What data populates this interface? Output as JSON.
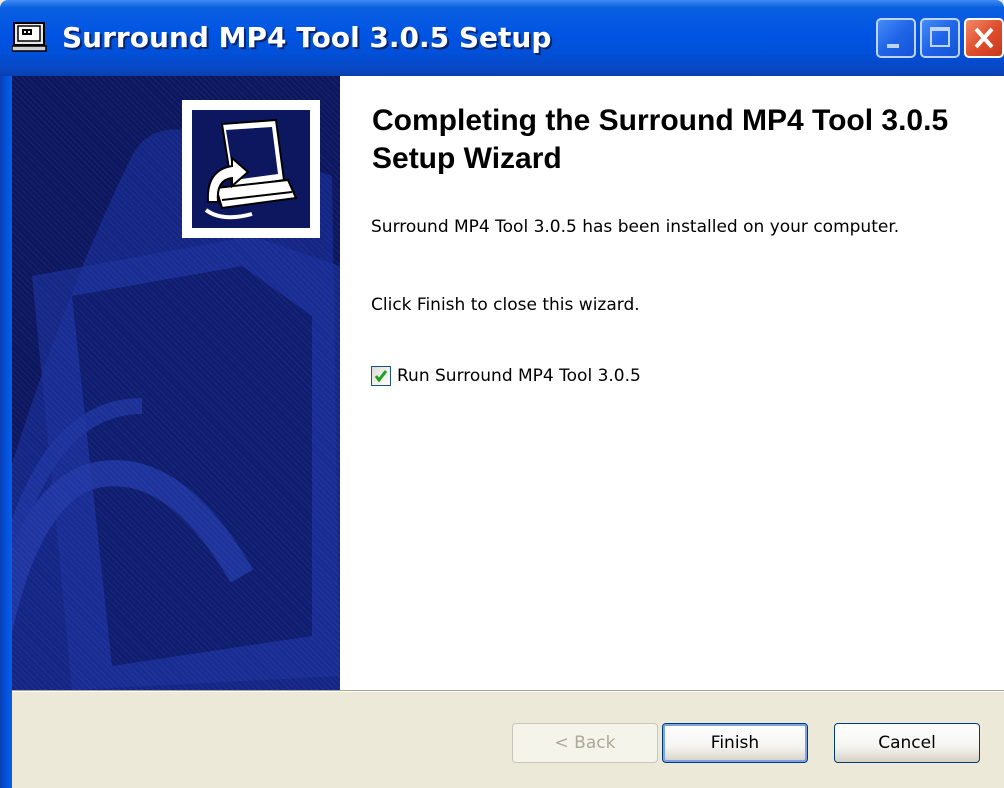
{
  "window": {
    "title": "Surround MP4 Tool 3.0.5 Setup",
    "icons": {
      "app": "installer-app-icon",
      "minimize": "minimize-icon",
      "maximize": "maximize-icon",
      "close": "close-icon"
    },
    "colors": {
      "titlebar": "#0054e3",
      "banner": "#0c1760",
      "close_button": "#e0502e"
    }
  },
  "banner": {
    "logo_icon": "computer-install-icon"
  },
  "content": {
    "heading": "Completing the Surround MP4 Tool 3.0.5 Setup Wizard",
    "paragraph1": "Surround MP4 Tool 3.0.5 has been installed on your computer.",
    "paragraph2": "Click Finish to close this wizard.",
    "run_checkbox": {
      "label": "Run Surround MP4 Tool 3.0.5",
      "checked": true
    }
  },
  "footer": {
    "back_label": "< Back",
    "back_enabled": false,
    "finish_label": "Finish",
    "cancel_label": "Cancel"
  }
}
